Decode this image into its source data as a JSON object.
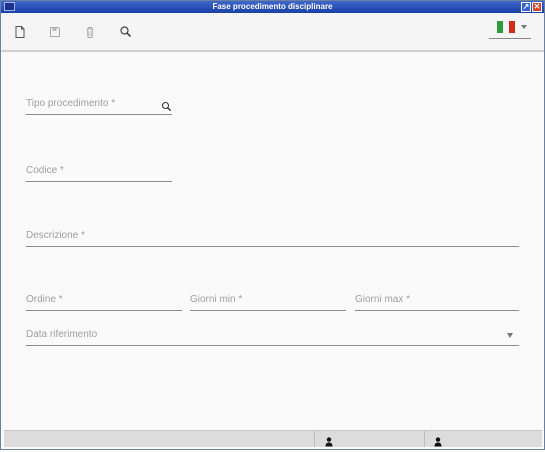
{
  "window": {
    "title": "Fase procedimento disciplinare"
  },
  "toolbar": {
    "buttons": [
      {
        "icon": "new-document-icon"
      },
      {
        "icon": "save-icon"
      },
      {
        "icon": "trash-icon"
      },
      {
        "icon": "search-icon"
      }
    ],
    "language": {
      "flag": "italy-flag-icon"
    }
  },
  "form": {
    "tipo_procedimento": {
      "label": "Tipo procedimento *"
    },
    "codice": {
      "label": "Codice *"
    },
    "descrizione": {
      "label": "Descrizione *"
    },
    "ordine": {
      "label": "Ordine *"
    },
    "giorni_min": {
      "label": "Giorni min *"
    },
    "giorni_max": {
      "label": "Giorni max *"
    },
    "data_riferimento": {
      "label": "Data riferimento"
    }
  },
  "statusbar": {
    "icons": [
      "user-icon",
      "user-icon"
    ]
  },
  "colors": {
    "titlebar": "#1a3fa5",
    "close": "#d9422b",
    "field_line": "#8c8c8c",
    "label": "#9e9e9e"
  }
}
